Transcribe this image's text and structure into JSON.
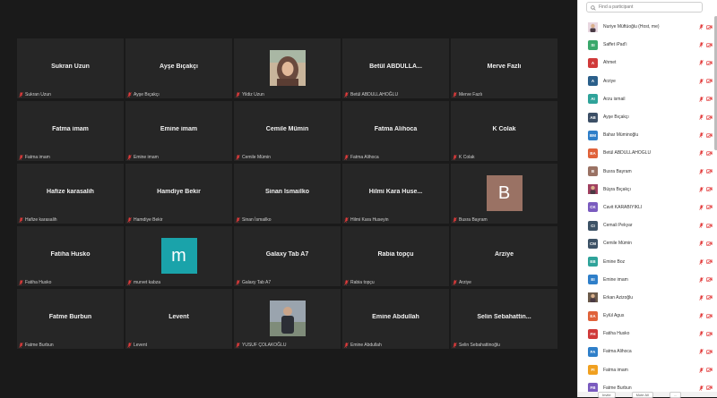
{
  "gallery": {
    "tiles": [
      {
        "name": "Sukran Uzun",
        "label": "Sukran Uzun",
        "type": "name"
      },
      {
        "name": "Ayşe Bıçakçı",
        "label": "Ayşe Bıçakçı",
        "type": "name"
      },
      {
        "name": "",
        "label": "Yildiz Uzun",
        "type": "photo",
        "photo": "woman-hijab"
      },
      {
        "name": "Betül ABDULLA...",
        "label": "Betül ABDULLAHOĞLU",
        "type": "name"
      },
      {
        "name": "Merve Fazlı",
        "label": "Merve Fazlı",
        "type": "name"
      },
      {
        "name": "Fatma imam",
        "label": "Fatma imam",
        "type": "name"
      },
      {
        "name": "Emine imam",
        "label": "Emine imam",
        "type": "name"
      },
      {
        "name": "Cemile Mümin",
        "label": "Cemile Mümin",
        "type": "name"
      },
      {
        "name": "Fatma Alihoca",
        "label": "Fatma Alihoca",
        "type": "name"
      },
      {
        "name": "K Colak",
        "label": "K Colak",
        "type": "name"
      },
      {
        "name": "Hafize karasalih",
        "label": "Hafize karasalih",
        "type": "name"
      },
      {
        "name": "Hamdiye Bekir",
        "label": "Hamdiye Bekir",
        "type": "name"
      },
      {
        "name": "Sinan İsmailko",
        "label": "Sinan İsmailko",
        "type": "name"
      },
      {
        "name": "Hilmi Kara Huse...",
        "label": "Hilmi Kara Huseyin",
        "type": "name"
      },
      {
        "name": "",
        "label": "Busra Bayram",
        "type": "avatar",
        "letter": "B",
        "color": "#9a7264"
      },
      {
        "name": "Fatiha Husko",
        "label": "Fatiha Husko",
        "type": "name"
      },
      {
        "name": "",
        "label": "murvet kabza",
        "type": "avatar",
        "letter": "m",
        "color": "#1aa3aa"
      },
      {
        "name": "Galaxy Tab A7",
        "label": "Galaxy Tab A7",
        "type": "name"
      },
      {
        "name": "Rabia topçu",
        "label": "Rabia topçu",
        "type": "name"
      },
      {
        "name": "Arziye",
        "label": "Arziye",
        "type": "name"
      },
      {
        "name": "Fatme Burbun",
        "label": "Fatme Burbun",
        "type": "name"
      },
      {
        "name": "Levent",
        "label": "Levent",
        "type": "name"
      },
      {
        "name": "",
        "label": "YUSUF ÇOLAKOĞLU",
        "type": "photo",
        "photo": "man-outdoor"
      },
      {
        "name": "Emine Abdullah",
        "label": "Emine Abdullah",
        "type": "name"
      },
      {
        "name": "Selin Sebahattin...",
        "label": "Selin Sebahattinoğlu",
        "type": "name"
      }
    ]
  },
  "panel": {
    "search_placeholder": "Find a participant",
    "participants": [
      {
        "name": "Nuriye Müftüoğlu (Host, me)",
        "initials": "",
        "color": "#e8d7e0",
        "photo": true
      },
      {
        "name": "Saffet iPad'i",
        "initials": "SI",
        "color": "#3aa86b"
      },
      {
        "name": "Ahmet",
        "initials": "A",
        "color": "#d03a3a"
      },
      {
        "name": "Arziye",
        "initials": "A",
        "color": "#2b5f8a"
      },
      {
        "name": "Arzu ismail",
        "initials": "AI",
        "color": "#2fa39a"
      },
      {
        "name": "Ayşe Bıçakçı",
        "initials": "AB",
        "color": "#3c4f66"
      },
      {
        "name": "Bahar Müminoğlu",
        "initials": "BM",
        "color": "#2f7fc9"
      },
      {
        "name": "Betül ABDULLAHOĞLU",
        "initials": "BA",
        "color": "#e0623a"
      },
      {
        "name": "Busra Bayram",
        "initials": "B",
        "color": "#9a7264"
      },
      {
        "name": "Büşra Bıçakçı",
        "initials": "",
        "color": "#a04060",
        "photo": true
      },
      {
        "name": "Cavit KARABIYIKLI",
        "initials": "CK",
        "color": "#7a5bbf"
      },
      {
        "name": "Cemali Pekyar",
        "initials": "CI",
        "color": "#3d5266"
      },
      {
        "name": "Cemile Mümin",
        "initials": "CM",
        "color": "#3d5266"
      },
      {
        "name": "Emine Boz",
        "initials": "EB",
        "color": "#2fa39a"
      },
      {
        "name": "Emine imam",
        "initials": "EI",
        "color": "#2f7fc9"
      },
      {
        "name": "Erkan Azizoğlu",
        "initials": "",
        "color": "#6b5a4a",
        "photo": true
      },
      {
        "name": "Eylül Agus",
        "initials": "EA",
        "color": "#e0623a"
      },
      {
        "name": "Fatiha Husko",
        "initials": "FH",
        "color": "#d03a3a"
      },
      {
        "name": "Fatma Alihoca",
        "initials": "FA",
        "color": "#2f7fc9"
      },
      {
        "name": "Fatma imam",
        "initials": "FI",
        "color": "#f0a020"
      },
      {
        "name": "Fatme Burbun",
        "initials": "FB",
        "color": "#7a5bbf"
      }
    ],
    "footer": {
      "invite_label": "Invite",
      "mute_all_label": "Mute All",
      "more_label": "..."
    }
  },
  "colors": {
    "muted_red": "#e23b3b",
    "panel_bg": "#ffffff",
    "gallery_bg": "#1a1a1a",
    "tile_bg": "#262626"
  }
}
